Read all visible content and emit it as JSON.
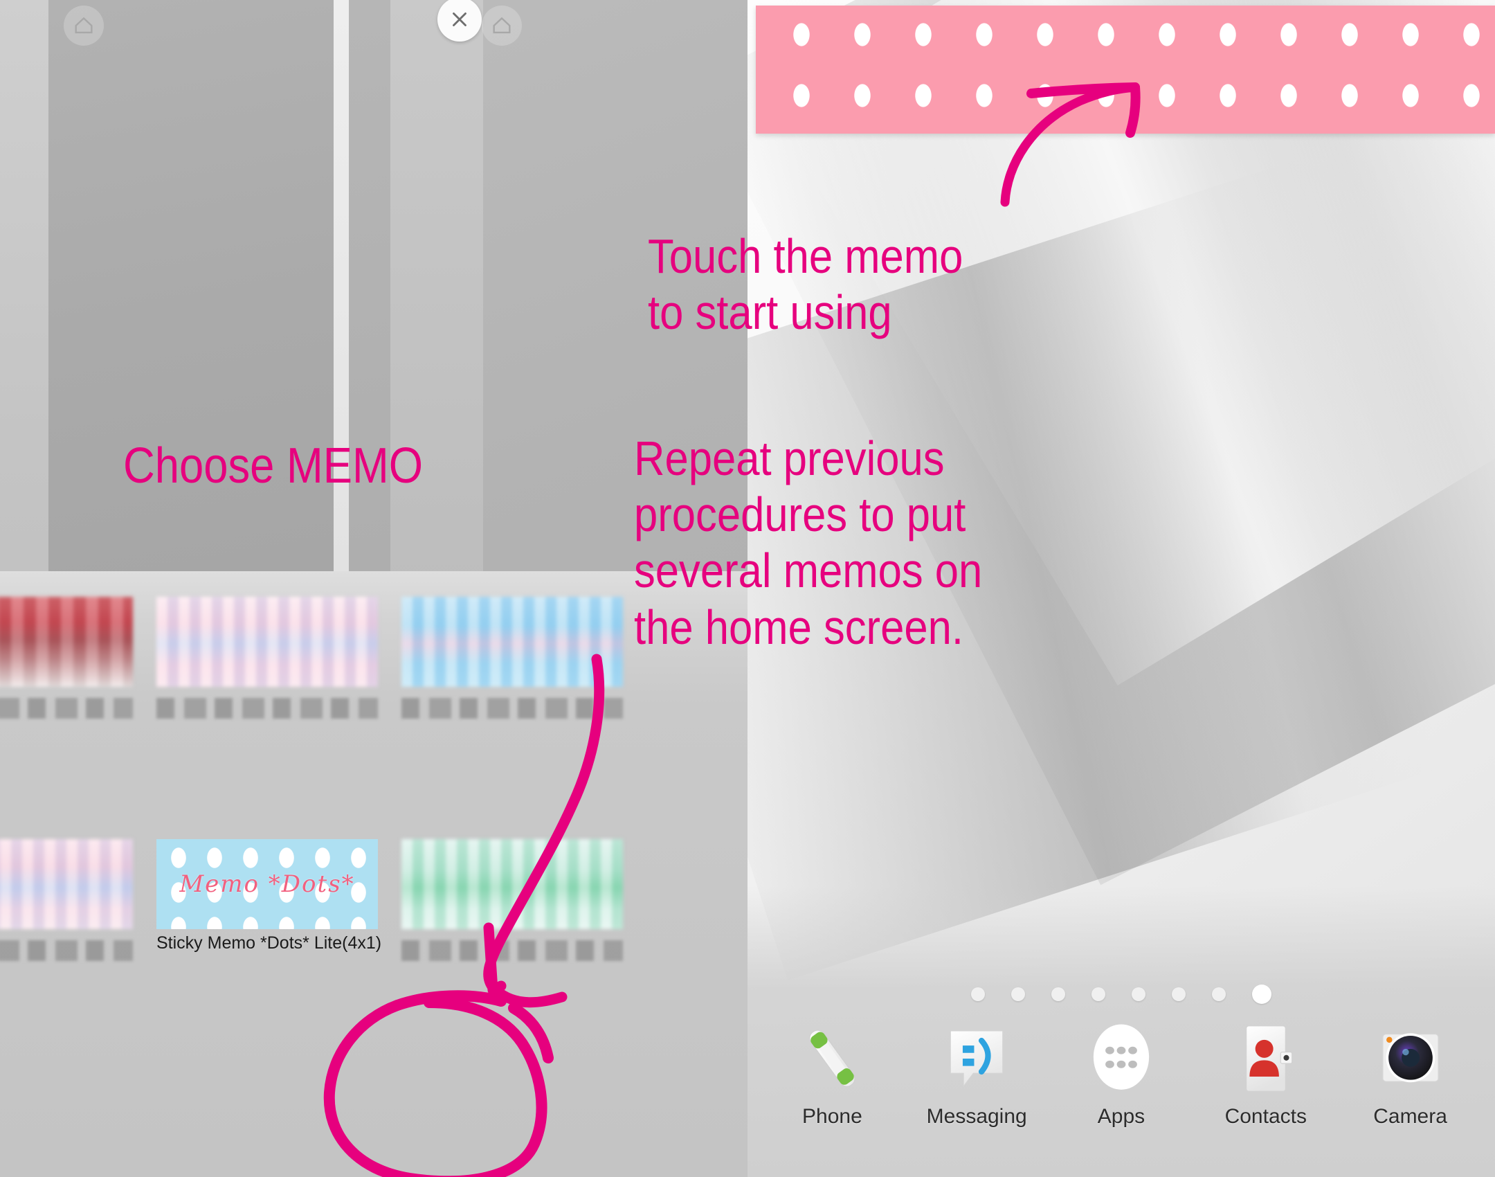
{
  "left_panel": {
    "name": "widget-picker",
    "buttons": {
      "home_left_label": "Home",
      "close_label": "Close"
    },
    "widgets": [
      {
        "label": "",
        "style": "px-red",
        "selected": false
      },
      {
        "label": "",
        "style": "px-pink",
        "selected": false
      },
      {
        "label": "",
        "style": "px-blue",
        "selected": false
      },
      {
        "label": "",
        "style": "px-pinkblue",
        "selected": false
      },
      {
        "label": "Sticky Memo *Dots* Lite(4x1)",
        "preview_text": "Memo *Dots*",
        "style": "memo-thumb",
        "selected": true
      },
      {
        "label": "",
        "style": "px-mint",
        "selected": false
      }
    ]
  },
  "right_panel": {
    "name": "home-screen",
    "memo_widget": {
      "label": "Sticky Memo Dots widget",
      "color": "#fb9cae",
      "dot_color": "#ffffff"
    },
    "page_indicator": {
      "total": 8,
      "active_index": 8
    },
    "dock": [
      {
        "label": "Phone",
        "icon": "phone-icon"
      },
      {
        "label": "Messaging",
        "icon": "message-bubble-icon"
      },
      {
        "label": "Apps",
        "icon": "apps-grid-icon"
      },
      {
        "label": "Contacts",
        "icon": "contacts-person-icon"
      },
      {
        "label": "Camera",
        "icon": "camera-lens-icon"
      }
    ]
  },
  "annotations": {
    "accent_color": "#e6007e",
    "choose_memo": "Choose MEMO",
    "touch_memo": "Touch the memo\nto start using",
    "repeat": "Repeat previous\nprocedures to put\nseveral memos on\nthe home screen."
  }
}
